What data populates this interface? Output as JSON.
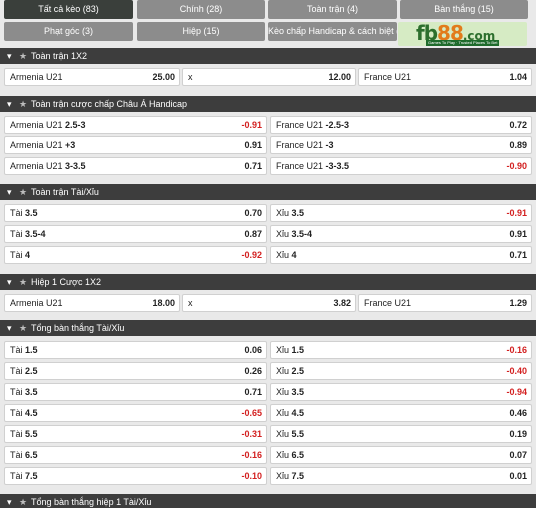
{
  "tabs": [
    {
      "label": "Tất cả kèo (83)",
      "active": true
    },
    {
      "label": "Chính (28)"
    },
    {
      "label": "Toàn trận (4)"
    },
    {
      "label": "Bàn thắng (15)"
    },
    {
      "label": "Phạt góc (3)"
    },
    {
      "label": "Hiệp (15)"
    },
    {
      "label": "Kèo chấp Handicap & cách biệt (3)"
    }
  ],
  "logo": {
    "fb": "fb",
    "num": "88",
    "com": ".com",
    "tagline": "Games To Play · Trusted Places To Bet"
  },
  "sections": [
    {
      "title": "Toàn trận 1X2",
      "rows": [
        [
          {
            "name": "Armenia U21",
            "line": "",
            "odd": "25.00",
            "neg": false
          },
          {
            "name": "x",
            "line": "",
            "odd": "12.00",
            "neg": false
          },
          {
            "name": "France U21",
            "line": "",
            "odd": "1.04",
            "neg": false
          }
        ]
      ]
    },
    {
      "title": "Toàn trận cược chấp Châu Á Handicap",
      "rows": [
        [
          {
            "name": "Armenia U21",
            "line": "2.5-3",
            "odd": "-0.91",
            "neg": true
          },
          {
            "name": "France U21",
            "line": "-2.5-3",
            "odd": "0.72",
            "neg": false
          }
        ],
        [
          {
            "name": "Armenia U21",
            "line": "+3",
            "odd": "0.91",
            "neg": false
          },
          {
            "name": "France U21",
            "line": "-3",
            "odd": "0.89",
            "neg": false
          }
        ],
        [
          {
            "name": "Armenia U21",
            "line": "3-3.5",
            "odd": "0.71",
            "neg": false
          },
          {
            "name": "France U21",
            "line": "-3-3.5",
            "odd": "-0.90",
            "neg": true
          }
        ]
      ]
    },
    {
      "title": "Toàn trận Tài/Xỉu",
      "rows": [
        [
          {
            "name": "Tài",
            "line": "3.5",
            "odd": "0.70",
            "neg": false
          },
          {
            "name": "Xỉu",
            "line": "3.5",
            "odd": "-0.91",
            "neg": true
          }
        ],
        [
          {
            "name": "Tài",
            "line": "3.5-4",
            "odd": "0.87",
            "neg": false
          },
          {
            "name": "Xỉu",
            "line": "3.5-4",
            "odd": "0.91",
            "neg": false
          }
        ],
        [
          {
            "name": "Tài",
            "line": "4",
            "odd": "-0.92",
            "neg": true
          },
          {
            "name": "Xỉu",
            "line": "4",
            "odd": "0.71",
            "neg": false
          }
        ]
      ]
    },
    {
      "title": "Hiệp 1 Cược 1X2",
      "rows": [
        [
          {
            "name": "Armenia U21",
            "line": "",
            "odd": "18.00",
            "neg": false
          },
          {
            "name": "x",
            "line": "",
            "odd": "3.82",
            "neg": false
          },
          {
            "name": "France U21",
            "line": "",
            "odd": "1.29",
            "neg": false
          }
        ]
      ]
    },
    {
      "title": "Tổng bàn thắng Tài/Xỉu",
      "rows": [
        [
          {
            "name": "Tài",
            "line": "1.5",
            "odd": "0.06",
            "neg": false
          },
          {
            "name": "Xỉu",
            "line": "1.5",
            "odd": "-0.16",
            "neg": true
          }
        ],
        [
          {
            "name": "Tài",
            "line": "2.5",
            "odd": "0.26",
            "neg": false
          },
          {
            "name": "Xỉu",
            "line": "2.5",
            "odd": "-0.40",
            "neg": true
          }
        ],
        [
          {
            "name": "Tài",
            "line": "3.5",
            "odd": "0.71",
            "neg": false
          },
          {
            "name": "Xỉu",
            "line": "3.5",
            "odd": "-0.94",
            "neg": true
          }
        ],
        [
          {
            "name": "Tài",
            "line": "4.5",
            "odd": "-0.65",
            "neg": true
          },
          {
            "name": "Xỉu",
            "line": "4.5",
            "odd": "0.46",
            "neg": false
          }
        ],
        [
          {
            "name": "Tài",
            "line": "5.5",
            "odd": "-0.31",
            "neg": true
          },
          {
            "name": "Xỉu",
            "line": "5.5",
            "odd": "0.19",
            "neg": false
          }
        ],
        [
          {
            "name": "Tài",
            "line": "6.5",
            "odd": "-0.16",
            "neg": true
          },
          {
            "name": "Xỉu",
            "line": "6.5",
            "odd": "0.07",
            "neg": false
          }
        ],
        [
          {
            "name": "Tài",
            "line": "7.5",
            "odd": "-0.10",
            "neg": true
          },
          {
            "name": "Xỉu",
            "line": "7.5",
            "odd": "0.01",
            "neg": false
          }
        ]
      ]
    },
    {
      "title": "Tổng bàn thắng hiệp 1 Tài/Xỉu",
      "rows": []
    }
  ],
  "icons": {
    "collapse": "caret-down-icon",
    "favorite": "star-icon"
  },
  "colors": {
    "header_bg": "#3d3d3d",
    "tab_bg": "#8c8c8c",
    "tab_active_bg": "#3a3f3b",
    "negative_odd": "#d32020"
  }
}
